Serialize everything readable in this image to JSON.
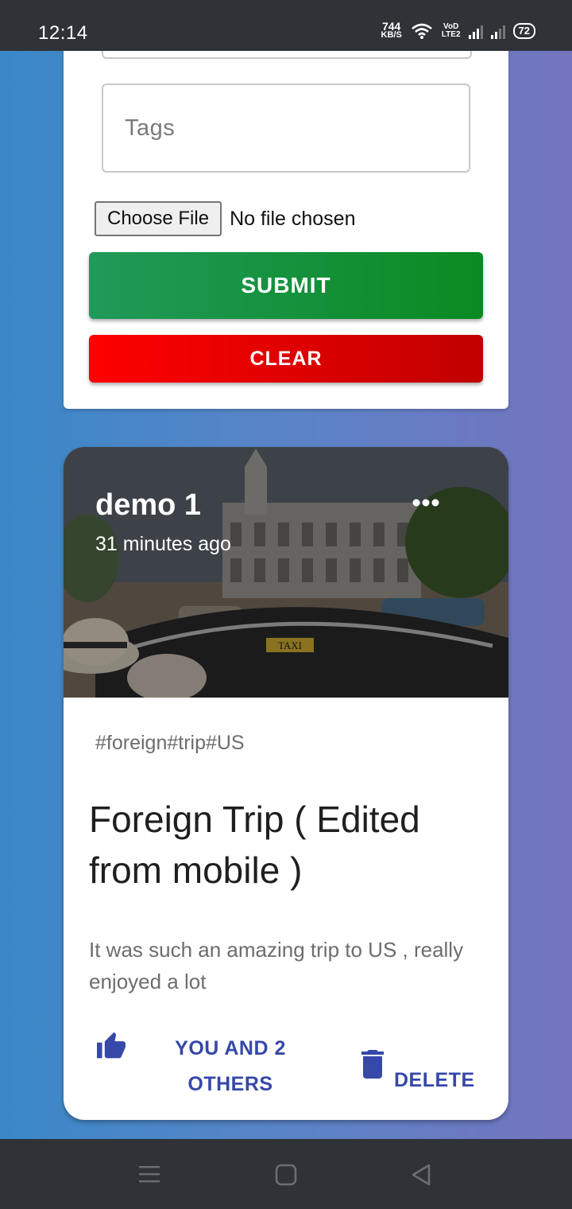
{
  "status_bar": {
    "time": "12:14",
    "speed_value": "744",
    "speed_unit": "KB/S",
    "network_top": "VoD",
    "network_bottom": "LTE2",
    "battery": "72"
  },
  "form": {
    "tags_placeholder": "Tags",
    "file_button_label": "Choose File",
    "file_status": "No file chosen",
    "submit_label": "SUBMIT",
    "clear_label": "CLEAR"
  },
  "post": {
    "author": "demo 1",
    "time_ago": "31 minutes ago",
    "tags": "#foreign#trip#US",
    "title": "Foreign Trip ( Edited from mobile )",
    "message": "It was such an amazing trip to US , really enjoyed a lot",
    "likes_label": "YOU AND 2 OTHERS",
    "delete_label": "DELETE",
    "image_text": "TAXI"
  },
  "colors": {
    "accent": "#3648a8",
    "submit_green": "#1a9650",
    "clear_red": "#ff0000",
    "gradient_left": "#3a88c8",
    "gradient_right": "#7474bf"
  },
  "icons": {
    "more": "more-horizontal-icon",
    "like": "thumb-up-icon",
    "delete": "trash-icon",
    "nav_menu": "menu-icon",
    "nav_home": "square-home-icon",
    "nav_back": "triangle-back-icon"
  }
}
